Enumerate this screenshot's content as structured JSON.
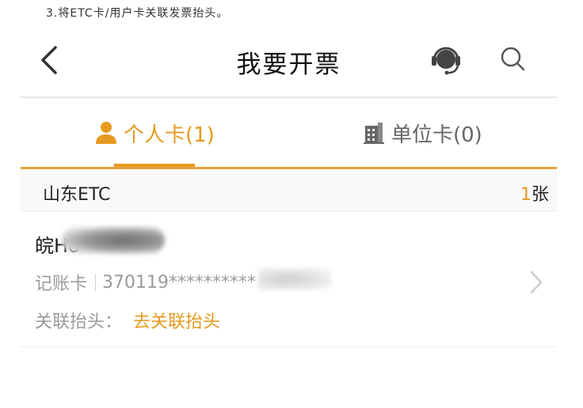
{
  "instruction": "3.将ETC卡/用户卡关联发票抬头。",
  "nav": {
    "title": "我要开票",
    "icons": {
      "back": "chevron-left-icon",
      "support": "headset-icon",
      "search": "search-icon"
    }
  },
  "tabs": [
    {
      "label": "个人卡(1)",
      "icon": "person-icon",
      "active": true
    },
    {
      "label": "单位卡(0)",
      "icon": "building-icon",
      "active": false
    }
  ],
  "section": {
    "region": "山东ETC",
    "count": "1",
    "count_unit": "张"
  },
  "card": {
    "holder_visible": "皖Ho",
    "account_label": "记账卡",
    "account_number": "370119**********",
    "link_label": "关联抬头：",
    "link_action": "去关联抬头"
  },
  "colors": {
    "accent": "#e69a1f",
    "text_primary": "#222222",
    "text_secondary": "#9b9b9b",
    "divider": "#e6e6e6"
  }
}
